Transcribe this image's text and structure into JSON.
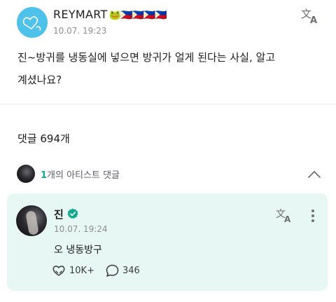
{
  "post": {
    "author": "REYMART",
    "author_emojis": "🐸🇵🇭🇵🇭🇵🇭🇵🇭",
    "timestamp": "10.07. 19:23",
    "body": "진~방귀를 냉동실에 넣으면 방귀가 얼게 된다는 사실, 알고\n계셨나요?",
    "translate_icon": "translate-icon"
  },
  "comments_section": {
    "label": "댓글 694개",
    "artist_reply_count": "1",
    "artist_reply_text": "개의 아티스트 댓글",
    "collapse_icon": "chevron-up-icon"
  },
  "reply": {
    "author": "진",
    "verified_icon": "verified-badge-icon",
    "timestamp": "10.07. 19:24",
    "body": "오 냉동방구",
    "likes": "10K+",
    "comments": "346",
    "accent_color": "#12a98f",
    "card_background": "#e7f7f3"
  }
}
